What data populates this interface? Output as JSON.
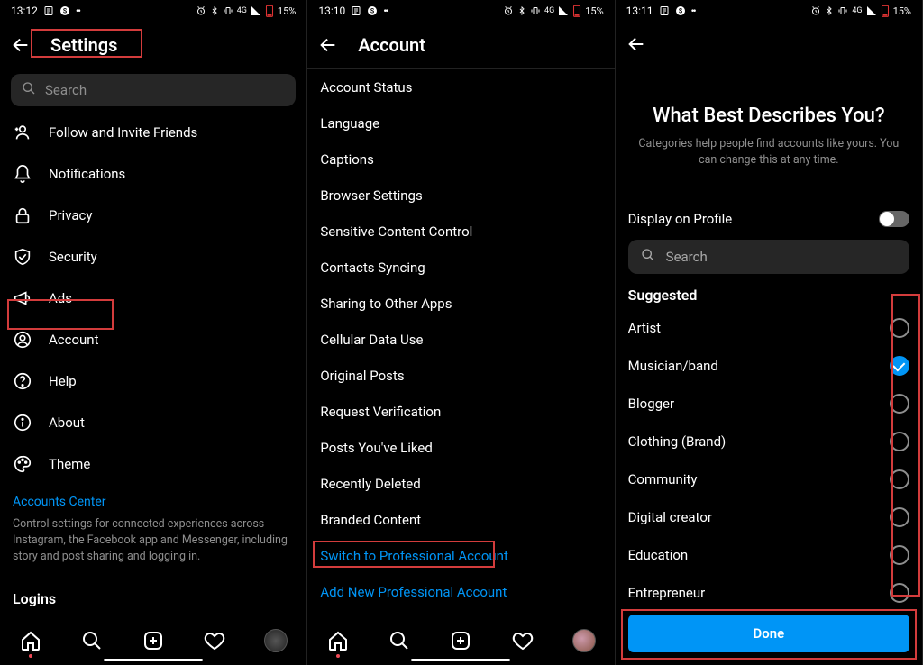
{
  "status": {
    "times": [
      "13:12",
      "13:10",
      "13:11"
    ],
    "battery": "15%",
    "net_label": "4G"
  },
  "screen1": {
    "title": "Settings",
    "search_placeholder": "Search",
    "items": [
      {
        "icon": "user-plus",
        "label": "Follow and Invite Friends"
      },
      {
        "icon": "bell",
        "label": "Notifications"
      },
      {
        "icon": "lock",
        "label": "Privacy"
      },
      {
        "icon": "shield",
        "label": "Security"
      },
      {
        "icon": "megaphone",
        "label": "Ads"
      },
      {
        "icon": "account",
        "label": "Account"
      },
      {
        "icon": "help",
        "label": "Help"
      },
      {
        "icon": "info",
        "label": "About"
      },
      {
        "icon": "palette",
        "label": "Theme"
      }
    ],
    "accounts_center_title": "Accounts Center",
    "accounts_center_desc": "Control settings for connected experiences across Instagram, the Facebook app and Messenger, including story and post sharing and logging in.",
    "logins_title": "Logins"
  },
  "screen2": {
    "title": "Account",
    "items": [
      "Account Status",
      "Language",
      "Captions",
      "Browser Settings",
      "Sensitive Content Control",
      "Contacts Syncing",
      "Sharing to Other Apps",
      "Cellular Data Use",
      "Original Posts",
      "Request Verification",
      "Posts You've Liked",
      "Recently Deleted",
      "Branded Content"
    ],
    "link1": "Switch to Professional Account",
    "link2": "Add New Professional Account"
  },
  "screen3": {
    "title": "What Best Describes You?",
    "subtitle": "Categories help people find accounts like yours. You can change this at any time.",
    "display_label": "Display on Profile",
    "search_placeholder": "Search",
    "suggested_label": "Suggested",
    "categories": [
      {
        "label": "Artist",
        "checked": false
      },
      {
        "label": "Musician/band",
        "checked": true
      },
      {
        "label": "Blogger",
        "checked": false
      },
      {
        "label": "Clothing (Brand)",
        "checked": false
      },
      {
        "label": "Community",
        "checked": false
      },
      {
        "label": "Digital creator",
        "checked": false
      },
      {
        "label": "Education",
        "checked": false
      },
      {
        "label": "Entrepreneur",
        "checked": false
      }
    ],
    "done_label": "Done"
  }
}
